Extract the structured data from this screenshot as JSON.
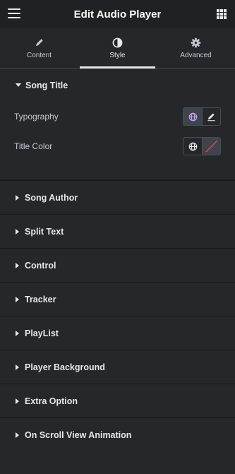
{
  "header": {
    "title": "Edit Audio Player",
    "menu_icon": "hamburger-icon",
    "apps_icon": "grid-icon"
  },
  "tabs": [
    {
      "label": "Content",
      "icon": "pencil-icon",
      "active": false
    },
    {
      "label": "Style",
      "icon": "half-circle-icon",
      "active": true
    },
    {
      "label": "Advanced",
      "icon": "gear-icon",
      "active": false
    }
  ],
  "open_section": {
    "title": "Song Title",
    "controls": [
      {
        "label": "Typography",
        "buttons": [
          "globe-icon",
          "pencil-icon"
        ]
      },
      {
        "label": "Title Color",
        "buttons": [
          "globe-icon",
          "no-color-slash-icon"
        ]
      }
    ]
  },
  "sections": [
    "Song Author",
    "Split Text",
    "Control",
    "Tracker",
    "PlayList",
    "Player Background",
    "Extra Option",
    "On Scroll View Animation"
  ],
  "colors": {
    "accent_globe": "#c8a6f5",
    "slash": "#d84f4f",
    "panel": "#26272b",
    "topbar": "#1f2124"
  }
}
